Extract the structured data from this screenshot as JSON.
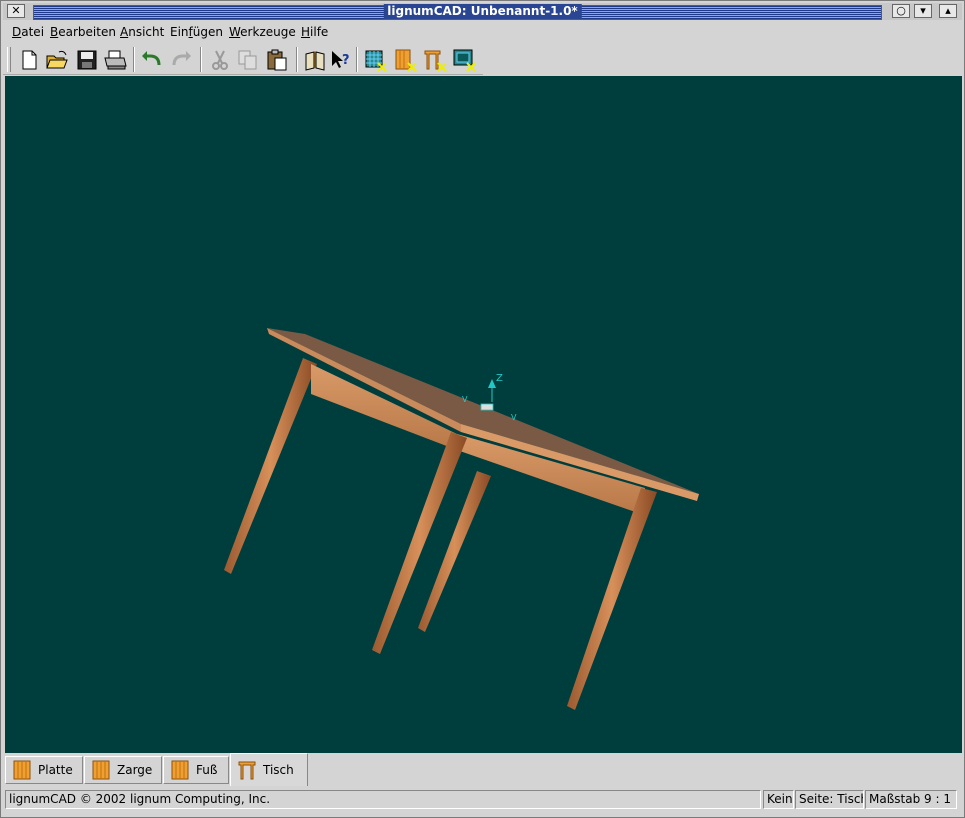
{
  "window": {
    "title": "lignumCAD: Unbenannt-1.0*"
  },
  "menubar": {
    "items": [
      {
        "label": "Datei",
        "mnemonic": "D"
      },
      {
        "label": "Bearbeiten",
        "mnemonic": "B"
      },
      {
        "label": "Ansicht",
        "mnemonic": "A"
      },
      {
        "label": "Einfügen",
        "mnemonic": "f"
      },
      {
        "label": "Werkzeuge",
        "mnemonic": "W"
      },
      {
        "label": "Hilfe",
        "mnemonic": "H"
      }
    ]
  },
  "toolbar": {
    "icons": [
      "new-document-icon",
      "open-folder-icon",
      "save-icon",
      "print-icon",
      "undo-icon",
      "redo-icon",
      "cut-icon",
      "copy-icon",
      "paste-icon",
      "manual-book-icon",
      "whats-this-icon",
      "new-sketch-icon",
      "new-part-icon",
      "new-assembly-icon",
      "new-page-icon"
    ]
  },
  "viewport": {
    "background": "#003e3e",
    "axes": {
      "z": "Z",
      "x": "V",
      "y": "V"
    },
    "colors": {
      "top": "#7a5a44",
      "edge": "#c98a5c",
      "leg": "#c07a4a",
      "axis": "#22c8c8"
    }
  },
  "tabs": [
    {
      "label": "Platte",
      "icon": "board-icon",
      "active": false
    },
    {
      "label": "Zarge",
      "icon": "board-icon",
      "active": false
    },
    {
      "label": "Fuß",
      "icon": "board-icon",
      "active": false
    },
    {
      "label": "Tisch",
      "icon": "table-icon",
      "active": true
    }
  ],
  "statusbar": {
    "message": "lignumCAD © 2002 lignum Computing, Inc.",
    "selection": "Kein",
    "page": "Seite: Tisch",
    "scale": "Maßstab 9 : 1"
  }
}
